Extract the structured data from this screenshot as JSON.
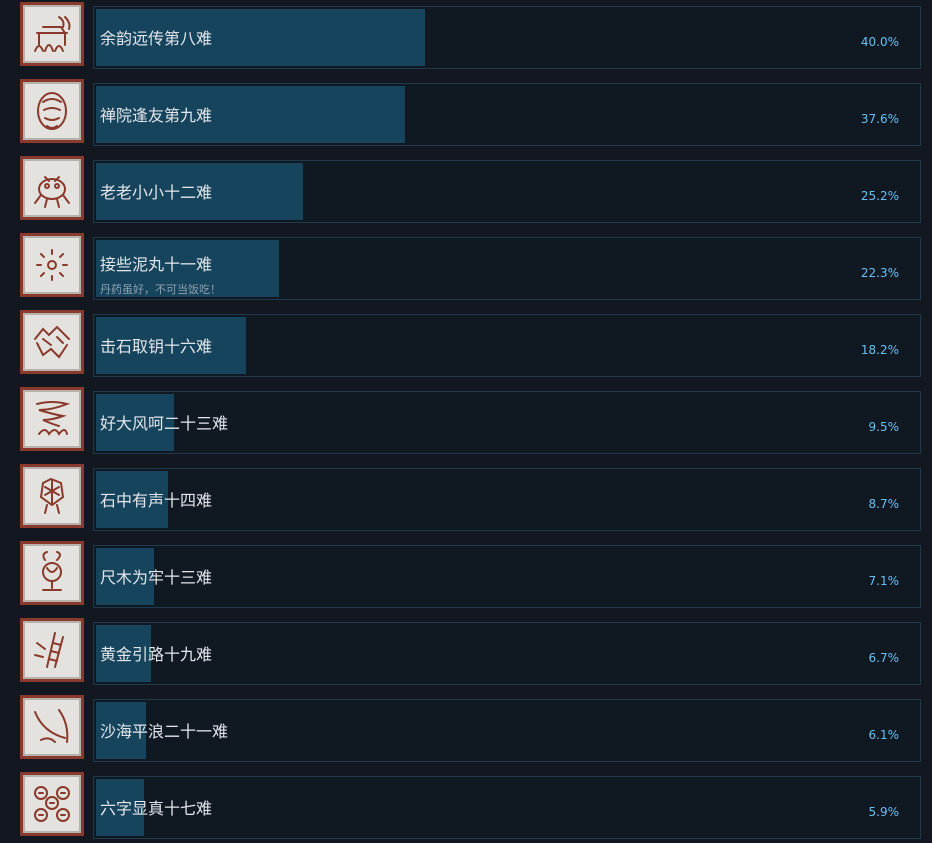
{
  "achievements": [
    {
      "name": "余韵远传第八难",
      "subtitle": "",
      "percent": "40.0%",
      "fraction": 0.4,
      "icon": "temple-bell-icon"
    },
    {
      "name": "禅院逢友第九难",
      "subtitle": "",
      "percent": "37.6%",
      "fraction": 0.376,
      "icon": "monk-face-icon"
    },
    {
      "name": "老老小小十二难",
      "subtitle": "",
      "percent": "25.2%",
      "fraction": 0.252,
      "icon": "frog-creature-icon"
    },
    {
      "name": "接些泥丸十一难",
      "subtitle": "丹药虽好，不可当饭吃！",
      "percent": "22.3%",
      "fraction": 0.223,
      "icon": "pill-dots-icon"
    },
    {
      "name": "击石取钥十六难",
      "subtitle": "",
      "percent": "18.2%",
      "fraction": 0.182,
      "icon": "mountain-rocks-icon"
    },
    {
      "name": "好大风呵二十三难",
      "subtitle": "",
      "percent": "9.5%",
      "fraction": 0.095,
      "icon": "whirlwind-icon"
    },
    {
      "name": "石中有声十四难",
      "subtitle": "",
      "percent": "8.7%",
      "fraction": 0.087,
      "icon": "stone-bird-icon"
    },
    {
      "name": "尺木为牢十三难",
      "subtitle": "",
      "percent": "7.1%",
      "fraction": 0.071,
      "icon": "burning-vase-icon"
    },
    {
      "name": "黄金引路十九难",
      "subtitle": "",
      "percent": "6.7%",
      "fraction": 0.067,
      "icon": "golden-ladder-icon"
    },
    {
      "name": "沙海平浪二十一难",
      "subtitle": "",
      "percent": "6.1%",
      "fraction": 0.061,
      "icon": "sand-wave-icon"
    },
    {
      "name": "六字显真十七难",
      "subtitle": "",
      "percent": "5.9%",
      "fraction": 0.059,
      "icon": "six-faces-icon"
    }
  ],
  "colors": {
    "background": "#131820",
    "bar_fill": "#17445d",
    "bar_border": "#1f3a4c",
    "percent_text": "#66c0f4",
    "icon_frame": "#8a3a2c"
  }
}
